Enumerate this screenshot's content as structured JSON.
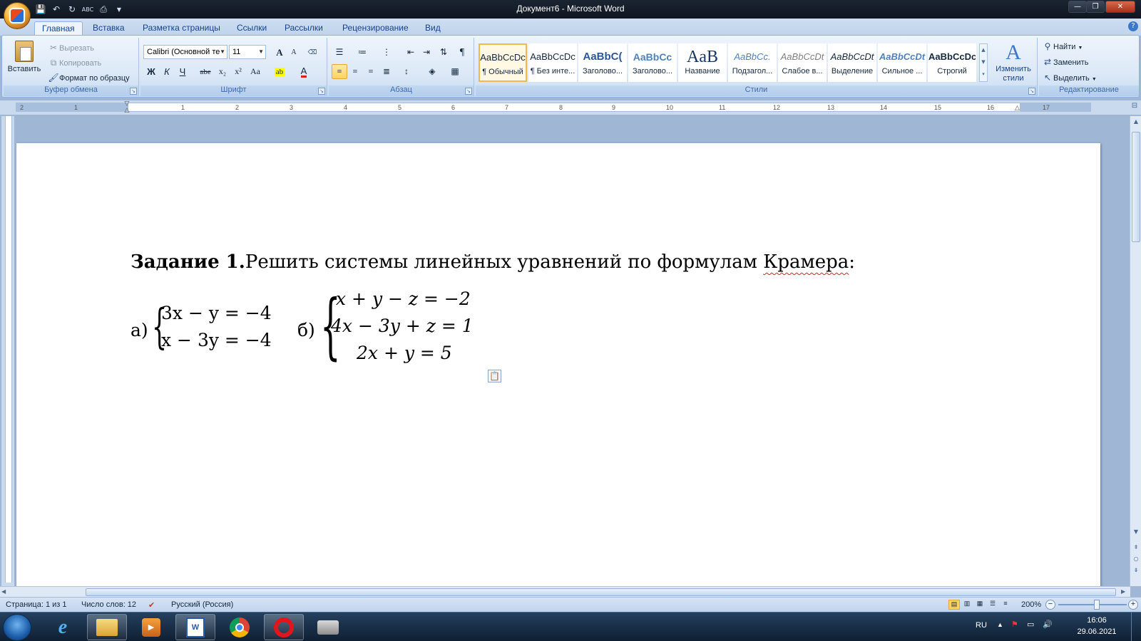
{
  "window": {
    "title": "Документ6 - Microsoft Word",
    "controls": {
      "minimize": "—",
      "maximize": "❐",
      "close": "✕"
    }
  },
  "quick_access": [
    "save-icon",
    "undo-icon",
    "redo-icon",
    "spelling-icon",
    "print-preview-icon"
  ],
  "tabs": [
    {
      "label": "Главная",
      "active": true
    },
    {
      "label": "Вставка"
    },
    {
      "label": "Разметка страницы"
    },
    {
      "label": "Ссылки"
    },
    {
      "label": "Рассылки"
    },
    {
      "label": "Рецензирование"
    },
    {
      "label": "Вид"
    }
  ],
  "ribbon": {
    "clipboard": {
      "label": "Буфер обмена",
      "paste": "Вставить",
      "cut": "Вырезать",
      "copy": "Копировать",
      "format_painter": "Формат по образцу"
    },
    "font": {
      "label": "Шрифт",
      "font_name": "Calibri (Основной те",
      "font_size": "11",
      "bold": "Ж",
      "italic": "К",
      "underline": "Ч",
      "strikethrough": "abe",
      "subscript": "x₂",
      "superscript": "x²",
      "change_case": "Aa",
      "grow": "A",
      "shrink": "A"
    },
    "paragraph": {
      "label": "Абзац"
    },
    "styles": {
      "label": "Стили",
      "items": [
        {
          "preview": "AaBbCcDc",
          "name": "¶ Обычный",
          "selected": true
        },
        {
          "preview": "AaBbCcDc",
          "name": "¶ Без инте..."
        },
        {
          "preview": "AaBbC(",
          "name": "Заголово..."
        },
        {
          "preview": "AaBbCc",
          "name": "Заголово..."
        },
        {
          "preview": "AaB",
          "name": "Название"
        },
        {
          "preview": "AaBbCc.",
          "name": "Подзагол..."
        },
        {
          "preview": "AaBbCcDt",
          "name": "Слабое в..."
        },
        {
          "preview": "AaBbCcDt",
          "name": "Выделение"
        },
        {
          "preview": "AaBbCcDt",
          "name": "Сильное ..."
        },
        {
          "preview": "AaBbCcDc",
          "name": "Строгий"
        }
      ],
      "change_styles": "Изменить стили"
    },
    "editing": {
      "label": "Редактирование",
      "find": "Найти",
      "replace": "Заменить",
      "select": "Выделить"
    }
  },
  "ruler": {
    "numbers": [
      "2",
      "1",
      "1",
      "2",
      "3",
      "4",
      "5",
      "6",
      "7",
      "8",
      "9",
      "10",
      "11",
      "12",
      "13",
      "14",
      "15",
      "16",
      "17"
    ]
  },
  "document": {
    "heading_bold": "Задание 1.",
    "heading_text": "Решить системы линейных уравнений по формулам ",
    "heading_flagged_word": "Крамера",
    "heading_end": ":",
    "system_a": {
      "label": "а)",
      "equations": [
        "3x − y = −4",
        "x − 3y = −4"
      ]
    },
    "system_b": {
      "label": "б)",
      "equations": [
        "x + y − z = −2",
        "4x − 3y + z = 1",
        "2x + y = 5"
      ]
    }
  },
  "statusbar": {
    "page": "Страница: 1 из 1",
    "words": "Число слов: 12",
    "language": "Русский (Россия)",
    "zoom": "200%"
  },
  "taskbar": {
    "apps": [
      "internet-explorer-icon",
      "file-explorer-icon",
      "media-player-icon",
      "word-icon",
      "chrome-icon",
      "opera-icon",
      "printer-app-icon"
    ],
    "language": "RU",
    "time": "16:06",
    "date": "29.06.2021"
  },
  "colors": {
    "ribbon_text": "#15428b",
    "accent_selected_style": "#f0b94b",
    "spell_error": "#e02020"
  }
}
